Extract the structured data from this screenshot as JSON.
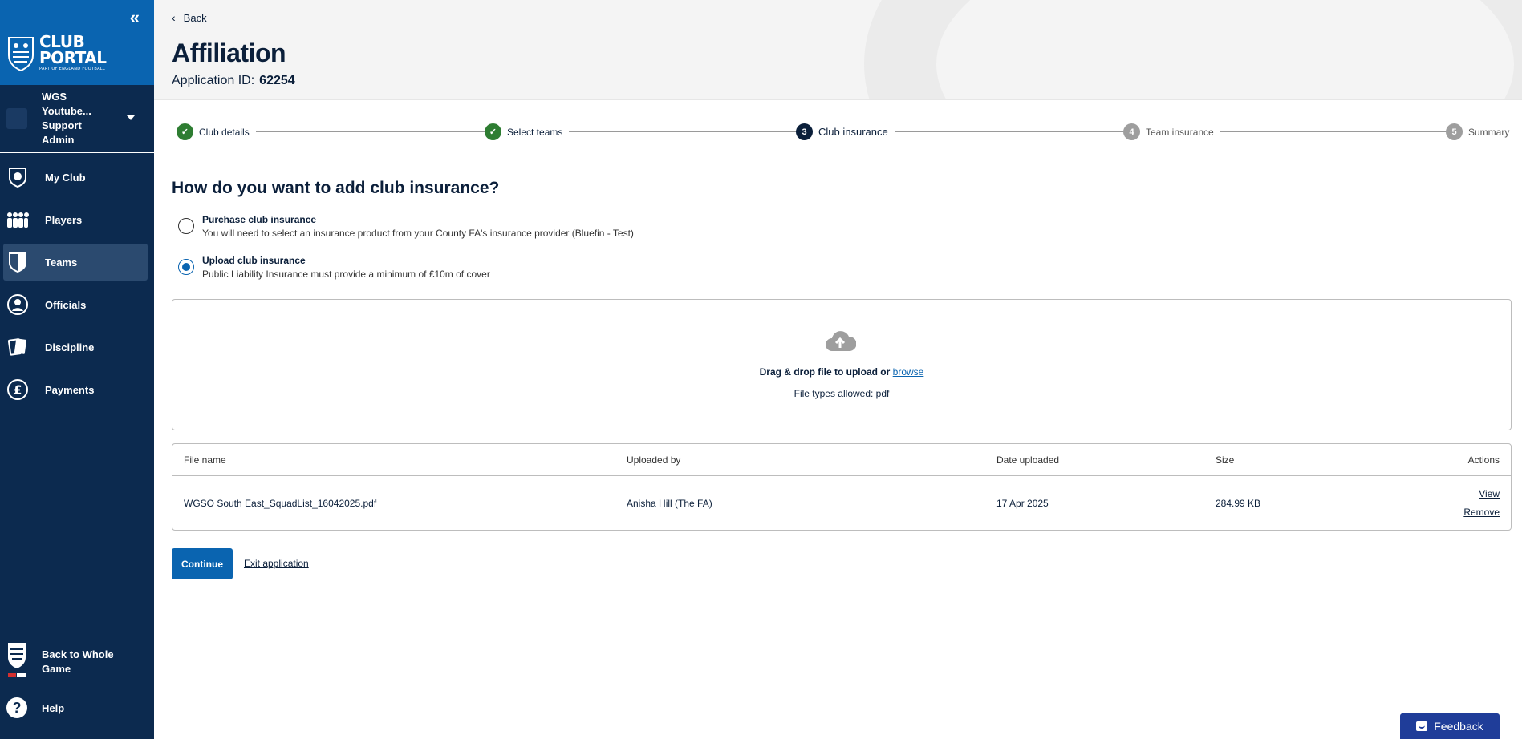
{
  "sidebar": {
    "logo_line1": "CLUB",
    "logo_line2": "PORTAL",
    "logo_sub": "PART OF ENGLAND FOOTBALL",
    "account_name": "WGS Youtube...",
    "account_role": "Support Admin",
    "nav": [
      {
        "label": "My Club",
        "icon": "club-badge-icon"
      },
      {
        "label": "Players",
        "icon": "players-icon"
      },
      {
        "label": "Teams",
        "icon": "shield-icon",
        "active": true
      },
      {
        "label": "Officials",
        "icon": "officials-icon"
      },
      {
        "label": "Discipline",
        "icon": "cards-icon"
      },
      {
        "label": "Payments",
        "icon": "pound-icon"
      }
    ],
    "back_to_whole_game": "Back to Whole Game",
    "help": "Help"
  },
  "header": {
    "back": "Back",
    "title": "Affiliation",
    "app_id_label": "Application ID:",
    "app_id_value": "62254"
  },
  "stepper": {
    "steps": [
      {
        "label": "Club details",
        "state": "done",
        "number": "1"
      },
      {
        "label": "Select teams",
        "state": "done",
        "number": "2"
      },
      {
        "label": "Club insurance",
        "state": "current",
        "number": "3"
      },
      {
        "label": "Team insurance",
        "state": "todo",
        "number": "4"
      },
      {
        "label": "Summary",
        "state": "todo",
        "number": "5"
      }
    ]
  },
  "form": {
    "question": "How do you want to add club insurance?",
    "options": [
      {
        "title": "Purchase club insurance",
        "description": "You will need to select an insurance product from your County FA's insurance provider (Bluefin - Test)",
        "checked": false
      },
      {
        "title": "Upload club insurance",
        "description": "Public Liability Insurance must provide a minimum of £10m of cover",
        "checked": true
      }
    ],
    "dropzone": {
      "text": "Drag & drop file to upload or",
      "browse": "browse",
      "allowed": "File types allowed: pdf"
    },
    "table": {
      "headers": [
        "File name",
        "Uploaded by",
        "Date uploaded",
        "Size",
        "Actions"
      ],
      "rows": [
        {
          "file_name": "WGSO South East_SquadList_16042025.pdf",
          "uploaded_by": "Anisha Hill (The FA)",
          "date": "17 Apr 2025",
          "size": "284.99 KB",
          "view": "View",
          "remove": "Remove"
        }
      ]
    },
    "continue": "Continue",
    "exit": "Exit application"
  },
  "feedback": "Feedback",
  "colors": {
    "sidebar": "#0c2a4f",
    "brand_blue": "#0a64b0",
    "done_green": "#2e7d32",
    "feedback": "#1f3d99"
  }
}
